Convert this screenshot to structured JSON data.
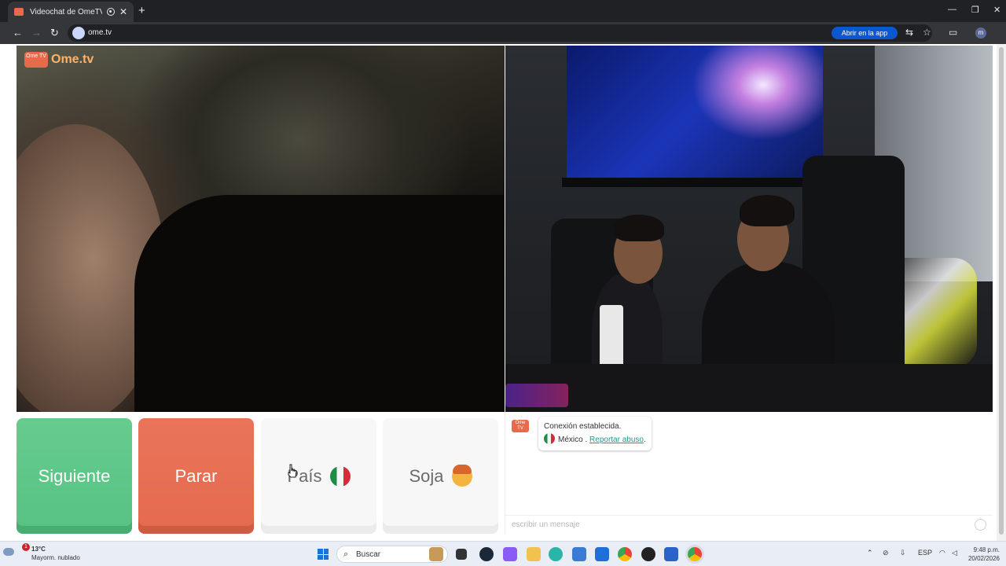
{
  "browser": {
    "tab_title": "Videochat de OmeTV: una a",
    "new_tab": "+",
    "url": "ome.tv",
    "open_in_app": "Abrir en la app",
    "profile_initial": "m"
  },
  "logo": {
    "badge": "Ome TV",
    "text": "Ome.tv"
  },
  "controls": {
    "next": "Siguiente",
    "stop": "Parar",
    "country": "País",
    "gender": "Soja"
  },
  "chat": {
    "avatar": "Ome TV",
    "connected": "Conexión establecida.",
    "country": "México",
    "separator": " . ",
    "report": "Reportar abuso",
    "report_suffix": ".",
    "placeholder": "escribir un mensaje"
  },
  "taskbar": {
    "weather_temp": "13°C",
    "weather_desc": "Mayorm. nublado",
    "weather_badge": "1",
    "search": "Buscar",
    "lang": "ESP",
    "time": "9:48 p.m.",
    "date": "20/02/2026"
  },
  "colors": {
    "next": "#56c283",
    "stop": "#e56a4f",
    "brand": "#e8694b",
    "report_link": "#1a9c8a"
  }
}
